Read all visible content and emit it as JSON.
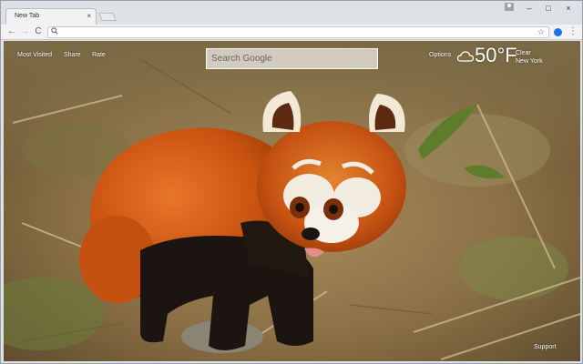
{
  "browser": {
    "tab_title": "New Tab",
    "tab_close": "×",
    "window_minimize": "–",
    "window_maximize": "□",
    "window_close": "×",
    "back": "←",
    "forward": "→",
    "reload": "C",
    "omnibox_icon": "🔍",
    "bookmark_star": "☆",
    "menu": "⋮"
  },
  "newtab": {
    "links": {
      "most_visited": "Most Visited",
      "share": "Share",
      "rate": "Rate",
      "options": "Options",
      "support": "Support"
    },
    "search": {
      "placeholder": "Search Google"
    },
    "weather": {
      "temperature": "50°F",
      "condition": "Clear",
      "city": "New York"
    }
  },
  "colors": {
    "chrome_frame": "#dee1e6",
    "toolbar": "#f2f2f2",
    "accent_blue": "#1a73e8",
    "panda_orange": "#d45a12",
    "panda_dark": "#1c1410"
  },
  "icons": {
    "weather": "cloud-icon",
    "extension": "extension-icon",
    "profile": "profile-icon"
  }
}
